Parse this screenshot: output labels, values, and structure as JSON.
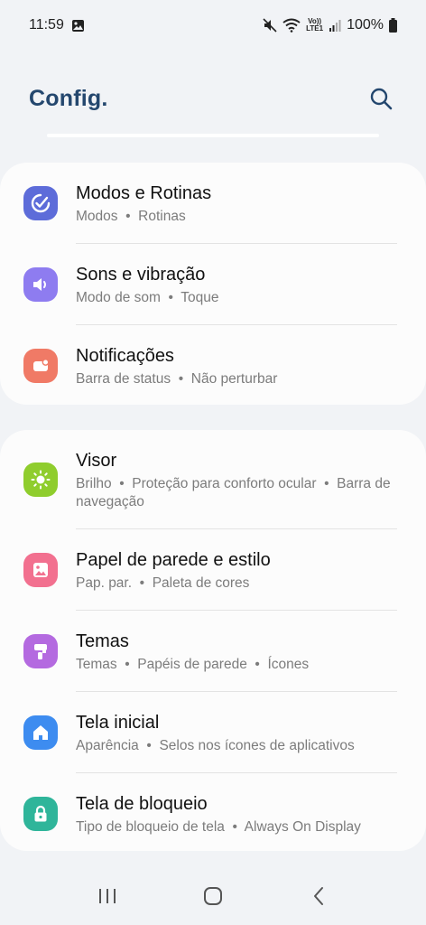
{
  "status_bar": {
    "time": "11:59",
    "volte_label_top": "Vo))",
    "volte_label_bottom": "LTE1",
    "battery_percent": "100%",
    "icons": [
      "gallery-icon",
      "mute-icon",
      "wifi-icon",
      "signal-icon",
      "battery-icon"
    ]
  },
  "header": {
    "title": "Config.",
    "search_icon": "search-icon"
  },
  "cards": [
    {
      "items": [
        {
          "title": "Modos e Rotinas",
          "sub": "Modos  •  Rotinas",
          "icon": "modes-routines-icon",
          "color": "#5d6cd9"
        },
        {
          "title": "Sons e vibração",
          "sub": "Modo de som  •  Toque",
          "icon": "volume-icon",
          "color": "#8e7cf0"
        },
        {
          "title": "Notificações",
          "sub": "Barra de status  •  Não perturbar",
          "icon": "notification-icon",
          "color": "#f07a66"
        }
      ]
    },
    {
      "items": [
        {
          "title": "Visor",
          "sub": "Brilho  •  Proteção para conforto ocular  •  Barra de navegação",
          "icon": "brightness-icon",
          "color": "#8fcd2d"
        },
        {
          "title": "Papel de parede e estilo",
          "sub": "Pap. par.  •  Paleta de cores",
          "icon": "wallpaper-icon",
          "color": "#f2708f"
        },
        {
          "title": "Temas",
          "sub": "Temas  •  Papéis de parede  •  Ícones",
          "icon": "themes-brush-icon",
          "color": "#b46ae0"
        },
        {
          "title": "Tela inicial",
          "sub": "Aparência  •  Selos nos ícones de aplicativos",
          "icon": "home-icon",
          "color": "#3d8cf0"
        },
        {
          "title": "Tela de bloqueio",
          "sub": "Tipo de bloqueio de tela  •  Always On Display",
          "icon": "lock-icon",
          "color": "#2fb59a"
        }
      ]
    }
  ],
  "nav_bar": {
    "icons": [
      "recents-icon",
      "home-nav-icon",
      "back-icon"
    ]
  }
}
